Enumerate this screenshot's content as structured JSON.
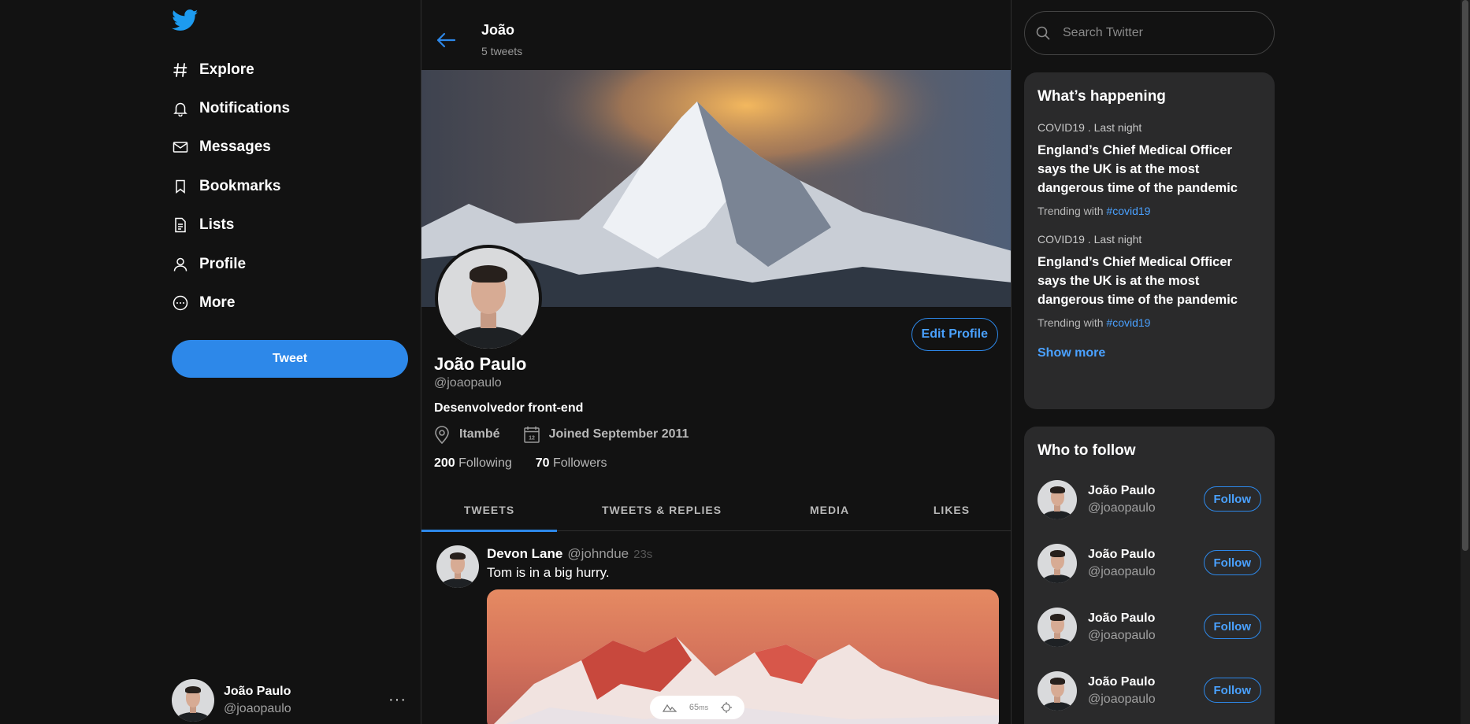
{
  "brand": {
    "icon": "twitter-bird-icon",
    "color": "#1d9bf0"
  },
  "nav": [
    {
      "label": "Explore",
      "icon": "hashtag-icon"
    },
    {
      "label": "Notifications",
      "icon": "bell-icon"
    },
    {
      "label": "Messages",
      "icon": "envelope-icon"
    },
    {
      "label": "Bookmarks",
      "icon": "bookmark-icon"
    },
    {
      "label": "Lists",
      "icon": "list-icon"
    },
    {
      "label": "Profile",
      "icon": "user-icon"
    },
    {
      "label": "More",
      "icon": "more-icon"
    }
  ],
  "tweet_button": "Tweet",
  "current_user": {
    "name": "João Paulo",
    "handle": "@joaopaulo",
    "menu": "···"
  },
  "header": {
    "title": "João",
    "subtitle": "5 tweets"
  },
  "profile": {
    "name": "João Paulo",
    "handle": "@joaopaulo",
    "bio": "Desenvolvedor front-end",
    "location": "Itambé",
    "joined": "Joined September 2011",
    "following_count": "200",
    "following_label": "Following",
    "followers_count": "70",
    "followers_label": "Followers",
    "edit_label": "Edit Profile"
  },
  "tabs": [
    "TWEETS",
    "TWEETS & REPLIES",
    "MEDIA",
    "LIKES"
  ],
  "post": {
    "name": "Devon Lane",
    "handle": "@johndue",
    "time": "23s",
    "text": "Tom is in a big hurry."
  },
  "overlay": {
    "value": "65",
    "unit": "ms"
  },
  "search": {
    "placeholder": "Search Twitter"
  },
  "happening": {
    "title": "What’s happening",
    "items": [
      {
        "meta": "COVID19 . Last night",
        "headline": "England’s Chief Medical Officer says the UK is at the most dangerous time of the pandemic",
        "trending_prefix": "Trending with",
        "tag": "#covid19"
      },
      {
        "meta": "COVID19 . Last night",
        "headline": "England’s Chief Medical Officer says the UK is at the most dangerous time of the pandemic",
        "trending_prefix": "Trending with",
        "tag": "#covid19"
      }
    ],
    "show_more": "Show more"
  },
  "who_to_follow": {
    "title": "Who to follow",
    "follow_label": "Follow",
    "people": [
      {
        "name": "João Paulo",
        "handle": "@joaopaulo"
      },
      {
        "name": "João Paulo",
        "handle": "@joaopaulo"
      },
      {
        "name": "João Paulo",
        "handle": "@joaopaulo"
      },
      {
        "name": "João Paulo",
        "handle": "@joaopaulo"
      }
    ]
  },
  "colors": {
    "accent": "#2d88e9",
    "background": "#121212",
    "card": "#2a2a2b"
  }
}
